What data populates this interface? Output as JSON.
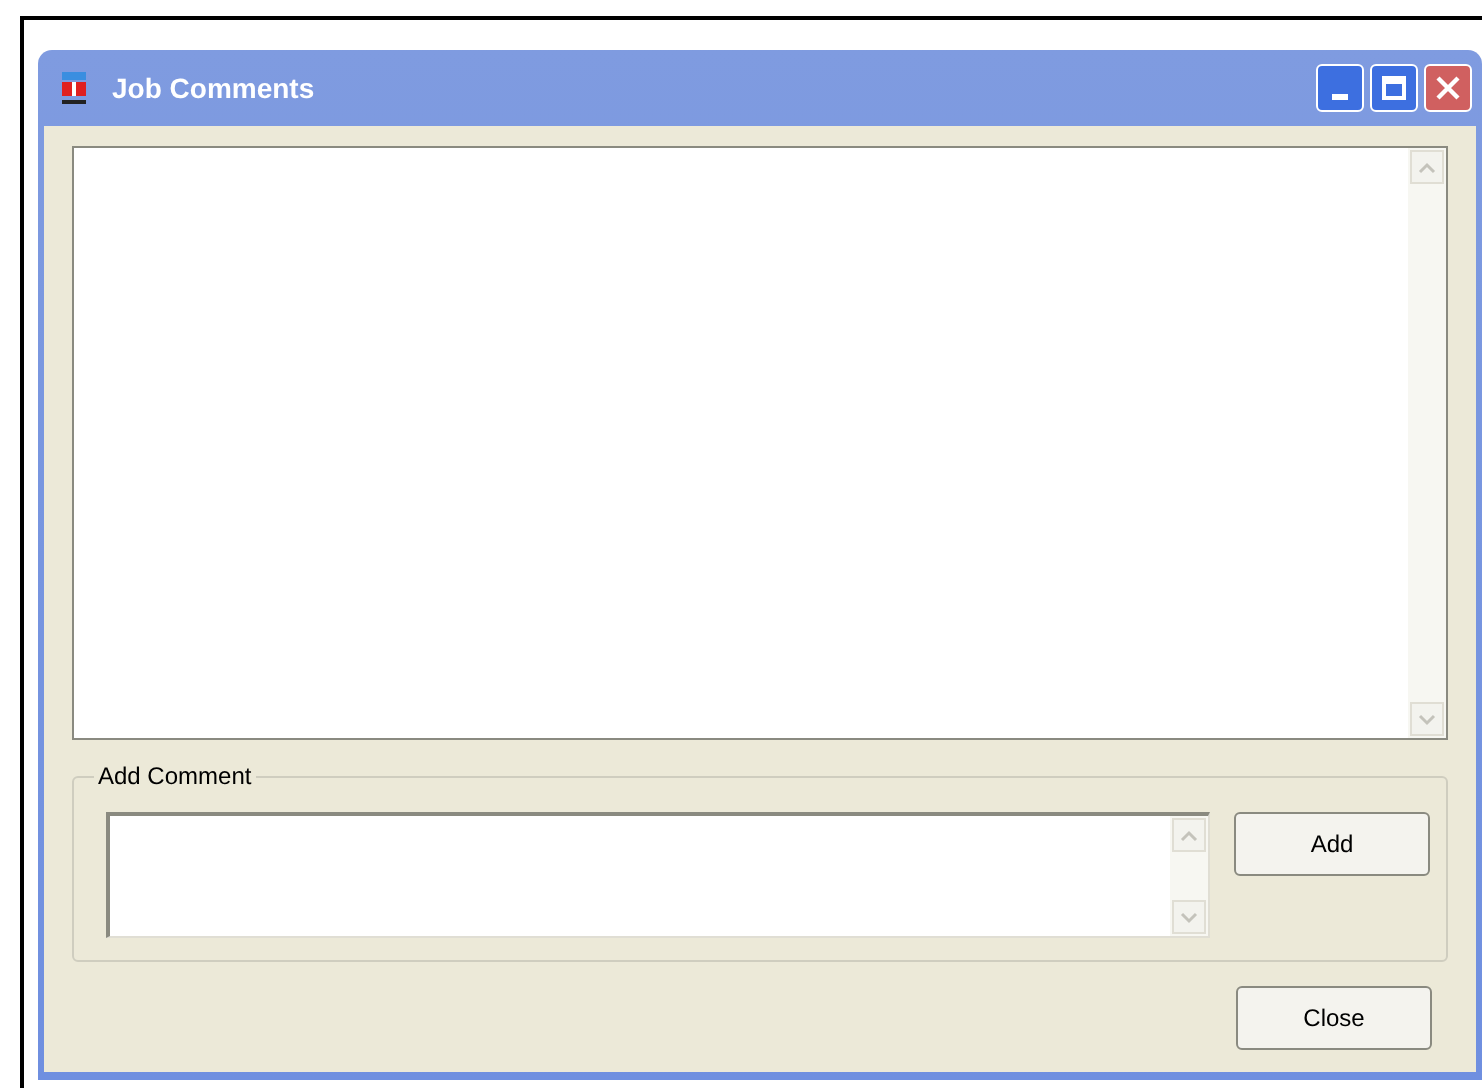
{
  "window": {
    "title": "Job Comments"
  },
  "add_comment": {
    "label": "Add Comment",
    "add_button": "Add"
  },
  "buttons": [
    "Close"
  ]
}
